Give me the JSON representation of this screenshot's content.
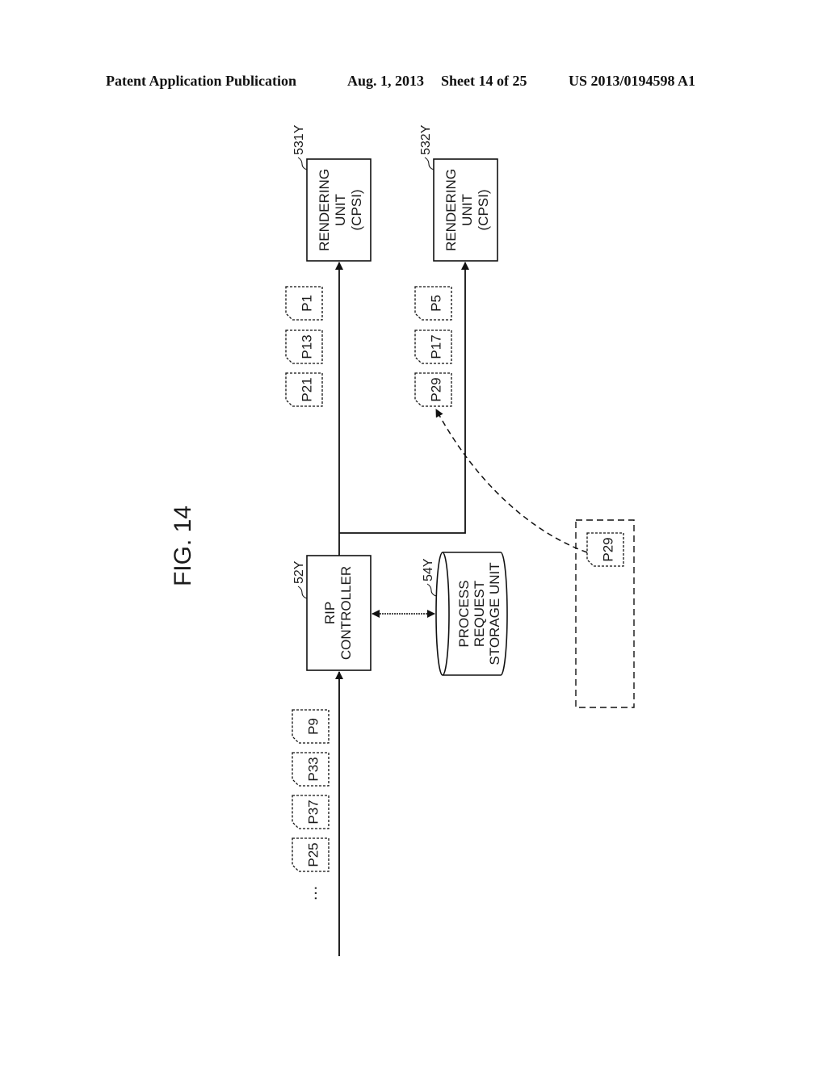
{
  "header": {
    "publication": "Patent Application Publication",
    "date": "Aug. 1, 2013",
    "sheet": "Sheet 14 of 25",
    "number": "US 2013/0194598 A1"
  },
  "figure": {
    "title": "FIG. 14",
    "rendering_unit_1": {
      "ref": "531Y",
      "lines": [
        "RENDERING",
        "UNIT",
        "(CPSI)"
      ]
    },
    "rendering_unit_2": {
      "ref": "532Y",
      "lines": [
        "RENDERING",
        "UNIT",
        "(CPSI)"
      ]
    },
    "rip_controller": {
      "ref": "52Y",
      "lines": [
        "RIP",
        "CONTROLLER"
      ]
    },
    "storage_unit": {
      "ref": "54Y",
      "lines": [
        "PROCESS",
        "REQUEST",
        "STORAGE UNIT"
      ]
    },
    "input_queue": [
      "P9",
      "P33",
      "P37",
      "P25"
    ],
    "input_ellipsis": "…",
    "queue_unit_1": [
      "P1",
      "P13",
      "P21"
    ],
    "queue_unit_2": [
      "P5",
      "P17",
      "P29"
    ],
    "held_page": "P29"
  }
}
